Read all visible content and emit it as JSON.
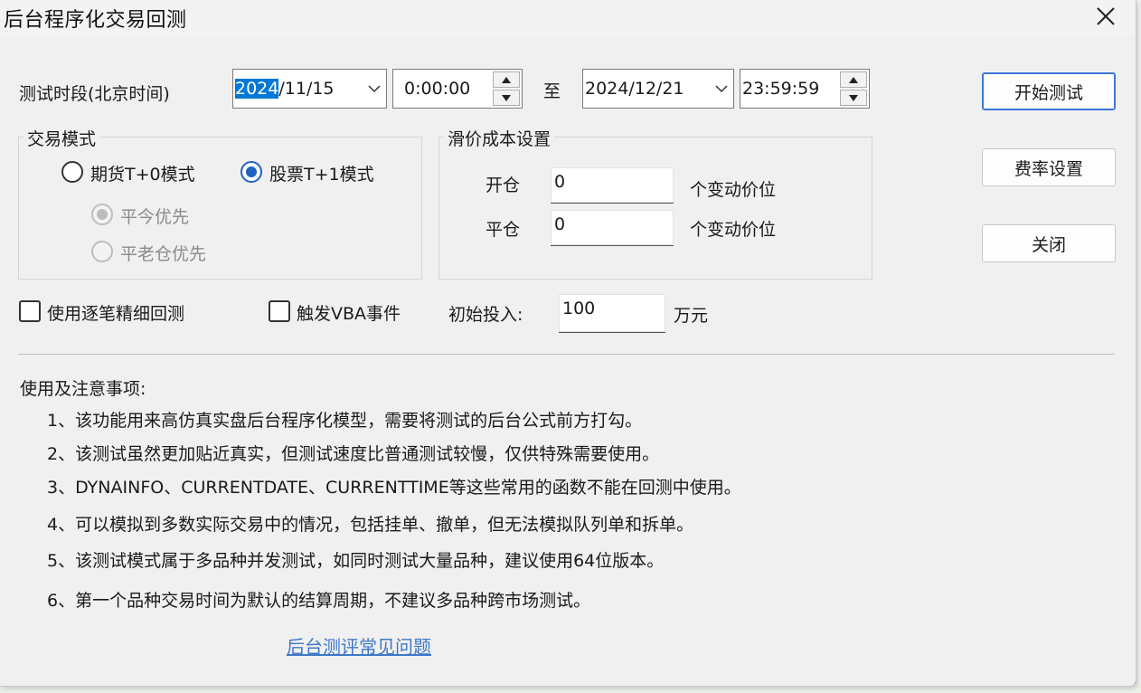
{
  "window": {
    "title": "后台程序化交易回测",
    "close_icon": "close-icon"
  },
  "period": {
    "label": "测试时段(北京时间)",
    "start_date_selected": "2024",
    "start_date_rest": "/11/15",
    "start_time": "0:00:00",
    "to_label": "至",
    "end_date": "2024/12/21",
    "end_time": "23:59:59"
  },
  "trade_mode": {
    "title": "交易模式",
    "futures_label": "期货T+0模式",
    "stock_label": "股票T+1模式",
    "selected": "stock",
    "sub_today_label": "平今优先",
    "sub_old_label": "平老仓优先"
  },
  "slippage": {
    "title": "滑价成本设置",
    "open_label": "开仓",
    "open_value": "0",
    "open_unit": "个变动价位",
    "close_label": "平仓",
    "close_value": "0",
    "close_unit": "个变动价位"
  },
  "options": {
    "tick_backtest_label": "使用逐笔精细回测",
    "vba_label": "触发VBA事件",
    "initial_label": "初始投入:",
    "initial_value": "100",
    "initial_unit": "万元"
  },
  "buttons": {
    "start": "开始测试",
    "fee": "费率设置",
    "close": "关闭"
  },
  "notes": {
    "title": "使用及注意事项:",
    "items": [
      "1、该功能用来高仿真实盘后台程序化模型，需要将测试的后台公式前方打勾。",
      "2、该测试虽然更加贴近真实，但测试速度比普通测试较慢，仅供特殊需要使用。",
      "3、DYNAINFO、CURRENTDATE、CURRENTTIME等这些常用的函数不能在回测中使用。",
      "4、可以模拟到多数实际交易中的情况，包括挂单、撤单，但无法模拟队列单和拆单。",
      "5、该测试模式属于多品种并发测试，如同时测试大量品种，建议使用64位版本。",
      "6、第一个品种交易时间为默认的结算周期，不建议多品种跨市场测试。"
    ]
  },
  "faq_link": "后台测评常见问题",
  "colors": {
    "accent": "#1f62c4",
    "link": "#3e78c8",
    "selection": "#0078d7"
  }
}
